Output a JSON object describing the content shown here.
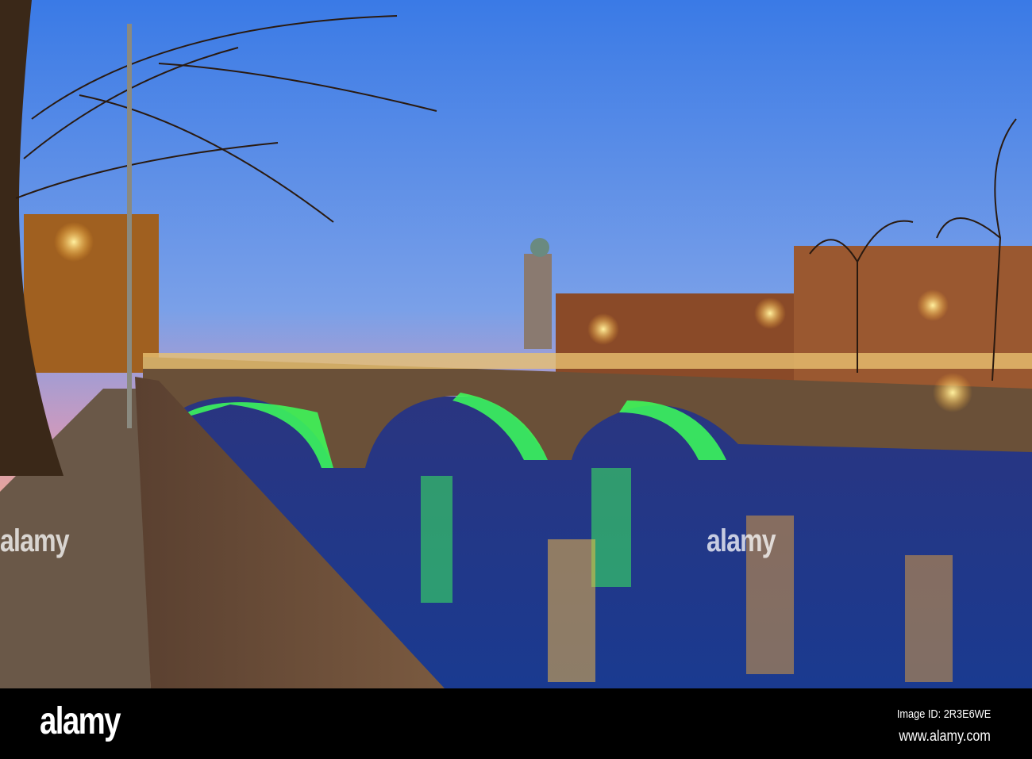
{
  "watermark": {
    "logo": "alamy",
    "image_id": "Image ID: 2R3E6WE",
    "website": "www.alamy.com"
  },
  "colors": {
    "sky_top": "#3f7fe0",
    "sky_horizon": "#e8a0a8",
    "bridge_arch_light": "#3cff5a",
    "street_light": "#ffb030",
    "water": "#1a2a70"
  }
}
